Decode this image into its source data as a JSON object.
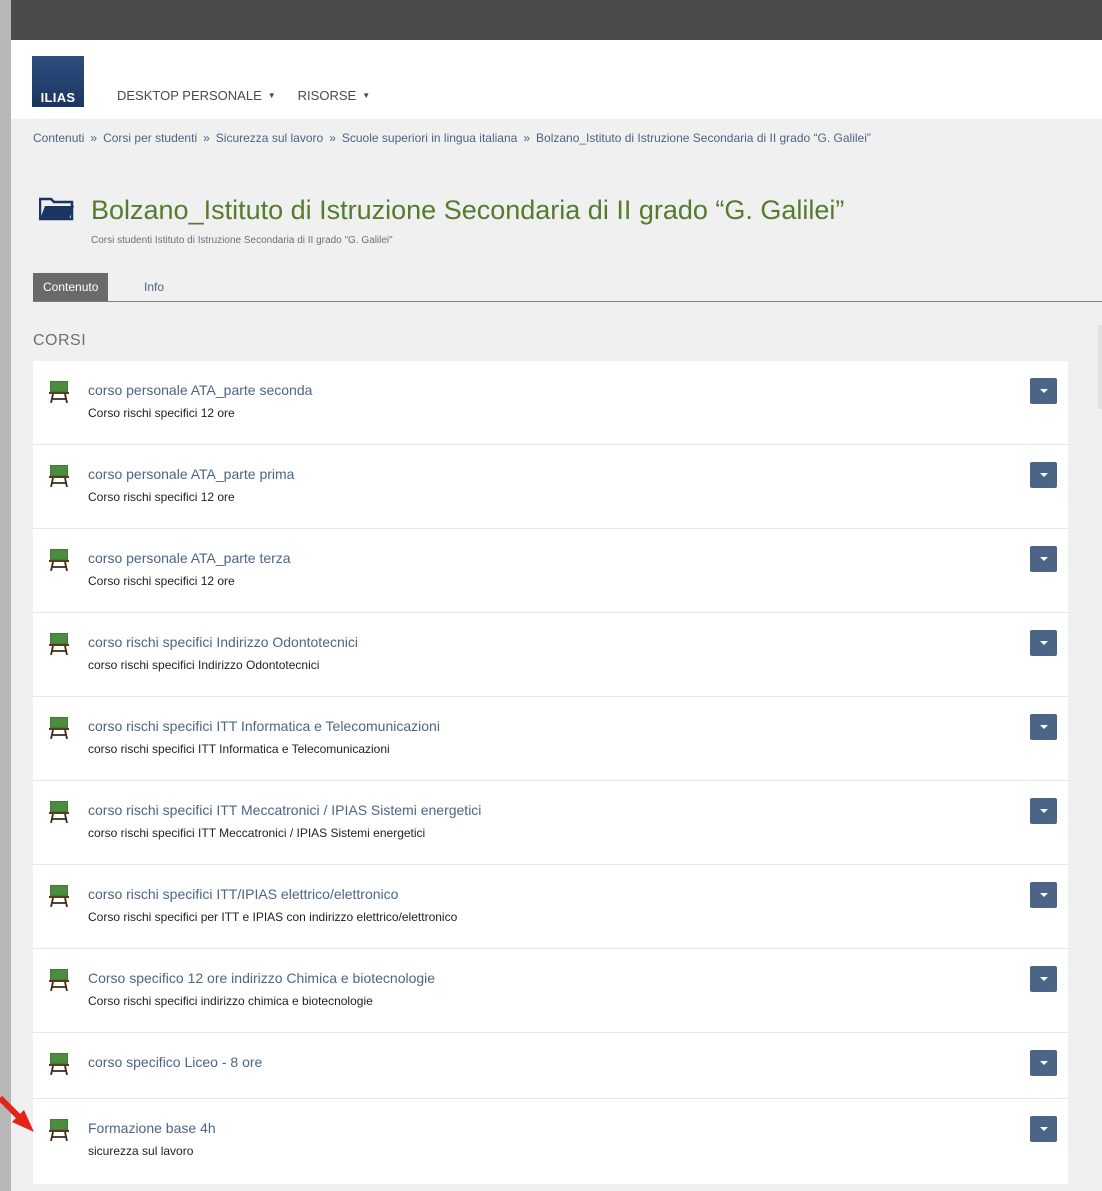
{
  "header": {
    "logo_text": "ILIAS",
    "nav": [
      {
        "label": "DESKTOP PERSONALE"
      },
      {
        "label": "RISORSE"
      }
    ]
  },
  "breadcrumb": {
    "items": [
      "Contenuti",
      "Corsi per studenti",
      "Sicurezza sul lavoro",
      "Scuole superiori in lingua italiana",
      "Bolzano_Istituto di Istruzione Secondaria di II grado “G. Galilei”"
    ],
    "separator": "»"
  },
  "page": {
    "title": "Bolzano_Istituto di Istruzione Secondaria di II grado “G. Galilei”",
    "subtitle": "Corsi studenti Istituto di Istruzione Secondaria di II grado \"G. Galilei\""
  },
  "tabs": [
    {
      "label": "Contenuto",
      "active": true
    },
    {
      "label": "Info",
      "active": false
    }
  ],
  "section": {
    "title": "CORSI"
  },
  "courses": [
    {
      "title": "corso personale ATA_parte seconda",
      "description": "Corso rischi specifici 12 ore"
    },
    {
      "title": "corso personale ATA_parte prima",
      "description": "Corso rischi specifici 12 ore"
    },
    {
      "title": "corso personale ATA_parte terza",
      "description": "Corso rischi specifici 12 ore"
    },
    {
      "title": "corso rischi specifici Indirizzo Odontotecnici",
      "description": "corso rischi specifici Indirizzo Odontotecnici"
    },
    {
      "title": "corso rischi specifici ITT Informatica e Telecomunicazioni",
      "description": "corso rischi specifici ITT Informatica e Telecomunicazioni"
    },
    {
      "title": "corso rischi specifici ITT Meccatronici / IPIAS Sistemi energetici",
      "description": "corso rischi specifici ITT Meccatronici / IPIAS Sistemi energetici"
    },
    {
      "title": "corso rischi specifici ITT/IPIAS elettrico/elettronico",
      "description": "Corso rischi specifici per ITT e IPIAS con indirizzo elettrico/elettronico"
    },
    {
      "title": "Corso specifico 12 ore indirizzo Chimica e biotecnologie",
      "description": "Corso rischi specifici indirizzo chimica e biotecnologie"
    },
    {
      "title": "corso specifico Liceo - 8 ore",
      "description": ""
    },
    {
      "title": "Formazione base 4h",
      "description": "sicurezza sul lavoro"
    }
  ],
  "colors": {
    "title_green": "#557b2e",
    "link_blue": "#4c6586",
    "action_button": "#4c6586",
    "annotation_arrow": "#e5231b"
  },
  "icons": {
    "course": "course-board-icon",
    "folder": "folder-open-icon",
    "action": "chevron-down-icon"
  }
}
